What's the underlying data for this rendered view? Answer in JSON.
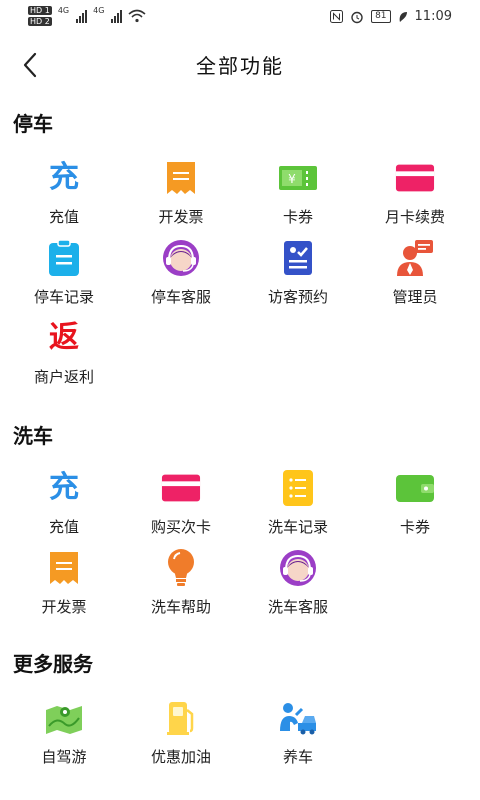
{
  "status_bar": {
    "sim1": "HD 1",
    "sim2": "HD 2",
    "net1": "4G",
    "net2": "4G",
    "battery": "81",
    "time": "11:09"
  },
  "header": {
    "title": "全部功能"
  },
  "sections": {
    "parking": {
      "title": "停车",
      "items": [
        "充值",
        "开发票",
        "卡券",
        "月卡续费",
        "停车记录",
        "停车客服",
        "访客预约",
        "管理员",
        "商户返利"
      ]
    },
    "carwash": {
      "title": "洗车",
      "items": [
        "充值",
        "购买次卡",
        "洗车记录",
        "卡券",
        "开发票",
        "洗车帮助",
        "洗车客服"
      ]
    },
    "more": {
      "title": "更多服务",
      "items": [
        "自驾游",
        "优惠加油",
        "养车"
      ]
    }
  },
  "icon_glyphs": {
    "recharge": "充",
    "rebate": "返"
  },
  "icons": {
    "recharge": "recharge-icon",
    "invoice": "receipt-icon",
    "coupon": "ticket-icon",
    "card": "card-icon",
    "records": "clipboard-icon",
    "support": "headset-icon",
    "visitor": "visitor-form-icon",
    "admin": "admin-person-icon",
    "rebate": "rebate-icon",
    "wallet": "wallet-icon",
    "help": "lightbulb-icon",
    "travel": "map-icon",
    "fuel": "fuel-pump-icon",
    "maintenance": "mechanic-icon"
  },
  "colors": {
    "blue": "#2b8fe6",
    "orange": "#f59a23",
    "green": "#5cc43a",
    "pink": "#ee2266",
    "cyan": "#1cb0ea",
    "purple": "#9b3ec6",
    "navy": "#3452c8",
    "red": "#e8141e",
    "yellow": "#ffc51a"
  }
}
